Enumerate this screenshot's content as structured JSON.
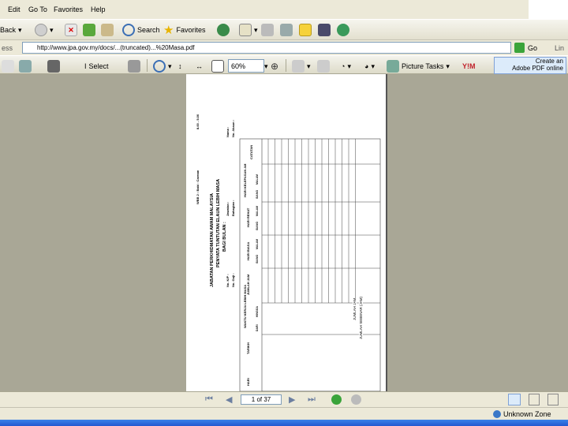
{
  "menu": [
    "Edit",
    "Go To",
    "Favorites",
    "Help"
  ],
  "toolbar": {
    "back_label": "Back",
    "search_label": "Search",
    "favorites_label": "Favorites"
  },
  "address": {
    "label": "ess",
    "url": "http://www.jpa.gov.my/docs/...(truncated)...%20Masa.pdf",
    "go_label": "Go",
    "links_label": "Lin"
  },
  "pdf_toolbar": {
    "select_label": "Select",
    "zoom_value": "60%",
    "picture_tasks_label": "Picture Tasks",
    "create_pdf_line1": "Create an",
    "create_pdf_line2": "Adobe PDF online"
  },
  "document": {
    "header_line1": "JABATAN PERKHIDMATAN AWAM MALAYSIA",
    "header_line2": "PENYATA TUNTUTAN ELAUN LEBIH MASA",
    "header_line3": "BAGI BULAN :",
    "wp": "WBB 2 : Babi : Caream",
    "hours": "8.00 - 5.00",
    "no_kp": "No. K/P :",
    "no_gaji": "No. Gaji :",
    "jawatan": "Jawatan :",
    "nama": "Nama :",
    "no_akaun": "No. Akaun :",
    "bahagian": "Bahagian :",
    "columns": [
      "HARI",
      "TARIKH",
      "WAKTU KERJA LEBIH MASA",
      "JUMLAH JAM",
      "HARI BIASA",
      "HARI REHAT",
      "HARI KELEPASAN AM",
      "CATATAN"
    ],
    "subcols": [
      "DARI",
      "HINGGA",
      "SIANG",
      "MALAM",
      "SIANG",
      "MALAM",
      "SIANG",
      "MALAM"
    ],
    "footer": [
      "JUMLAH JAM",
      "JUMLAH SEBENAR (JAM)"
    ]
  },
  "navigation": {
    "page_display": "1 of 37"
  },
  "status": {
    "zone_label": "Unknown Zone"
  }
}
